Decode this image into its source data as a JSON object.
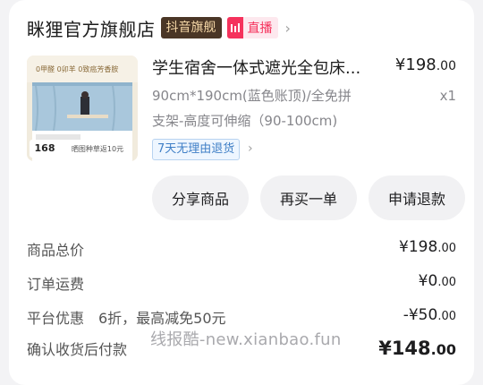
{
  "store": {
    "name": "眯狸官方旗舰店",
    "badge_flagship": "抖音旗舰",
    "badge_live": "直播",
    "chevron_icon": "chevron-right-icon",
    "live_icon": "live-bars-icon"
  },
  "product": {
    "thumb": {
      "price_tag": "168",
      "promo": "晒图种草返10元",
      "caption": "0甲醛 0卯羊 0致癌芳香胺"
    },
    "title": "学生宿舍一体式遮光全包床...",
    "spec_line1": "90cm*190cm(蓝色账顶)/全免拼",
    "spec_line2": "支架-高度可伸缩（90-100cm)",
    "price_int": "¥198",
    "price_dec": ".00",
    "quantity": "x1",
    "return_tag": "7天无理由退货"
  },
  "actions": {
    "share": "分享商品",
    "rebuy": "再买一单",
    "refund": "申请退款"
  },
  "fees": {
    "subtotal_label": "商品总价",
    "subtotal_int": "¥198",
    "subtotal_dec": ".00",
    "shipping_label": "订单运费",
    "shipping_int": "¥0",
    "shipping_dec": ".00",
    "discount_label": "平台优惠　6折，最高减免50元",
    "discount_int": "-¥50",
    "discount_dec": ".00",
    "total_label": "确认收货后付款",
    "total_int": "¥148",
    "total_dec": ".00"
  },
  "watermark": "线报酷-new.xianbao.fun",
  "colors": {
    "live_pink": "#f5325c",
    "flagship_brown": "#4a3626",
    "return_blue": "#3f7fc6"
  }
}
